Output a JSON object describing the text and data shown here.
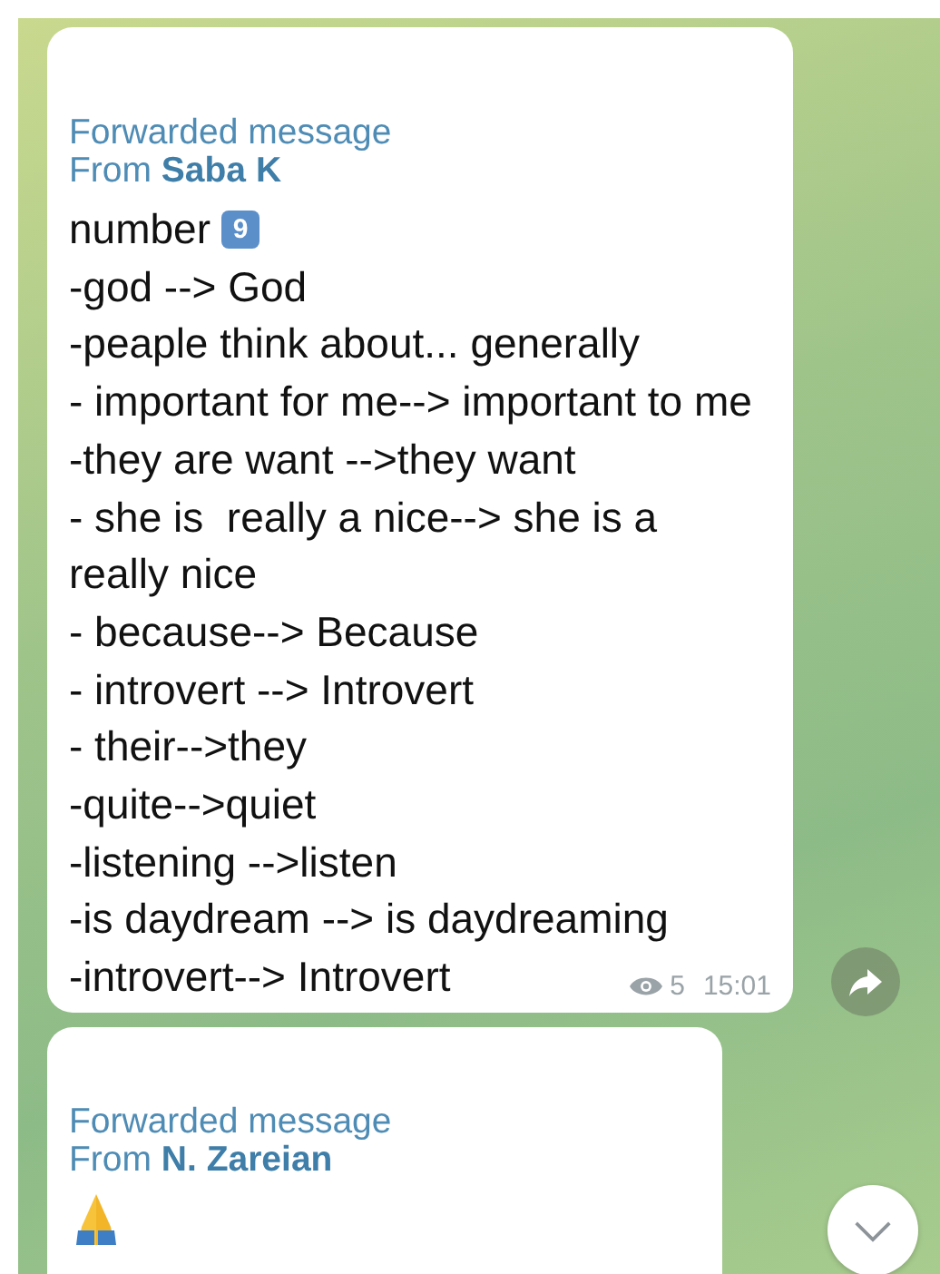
{
  "messages": [
    {
      "forwarded_label": "Forwarded message",
      "from_prefix": "From",
      "sender": "Saba K",
      "first_line": "number",
      "keycap": "9",
      "lines": [
        "-god --> God",
        "-peaple think about... generally",
        "- important for me--> important to me",
        "-they are want -->they want",
        "- she is  really a nice--> she is a",
        "really nice",
        "- because--> Because",
        "- introvert --> Introvert",
        "- their-->they",
        "-quite-->quiet",
        "-listening -->listen",
        "-is daydream --> is daydreaming",
        "-introvert--> Introvert"
      ],
      "views": "5",
      "time": "15:01"
    },
    {
      "forwarded_label": "Forwarded message",
      "from_prefix": "From",
      "sender": "N. Zareian"
    }
  ]
}
